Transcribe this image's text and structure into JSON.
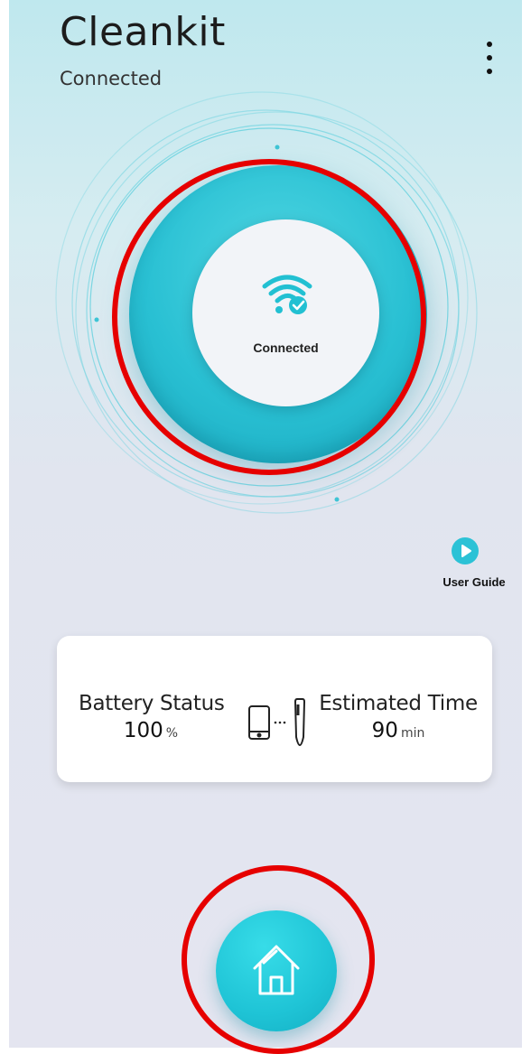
{
  "header": {
    "title": "Cleankit",
    "subtitle": "Connected",
    "menu_icon": "more-vert-icon"
  },
  "connection": {
    "status_label": "Connected",
    "icon": "wifi-check-icon",
    "ring_color": "#29c0d3"
  },
  "user_guide": {
    "label": "User Guide",
    "icon": "play-icon"
  },
  "status_card": {
    "battery": {
      "label": "Battery Status",
      "value": "100",
      "unit": "%"
    },
    "device_icon": "phone-to-device-icon",
    "estimate": {
      "label": "Estimated Time",
      "value": "90",
      "unit": "min"
    }
  },
  "nav": {
    "home_icon": "home-icon"
  },
  "colors": {
    "accent": "#29c0d3",
    "annotation": "#e60000"
  }
}
